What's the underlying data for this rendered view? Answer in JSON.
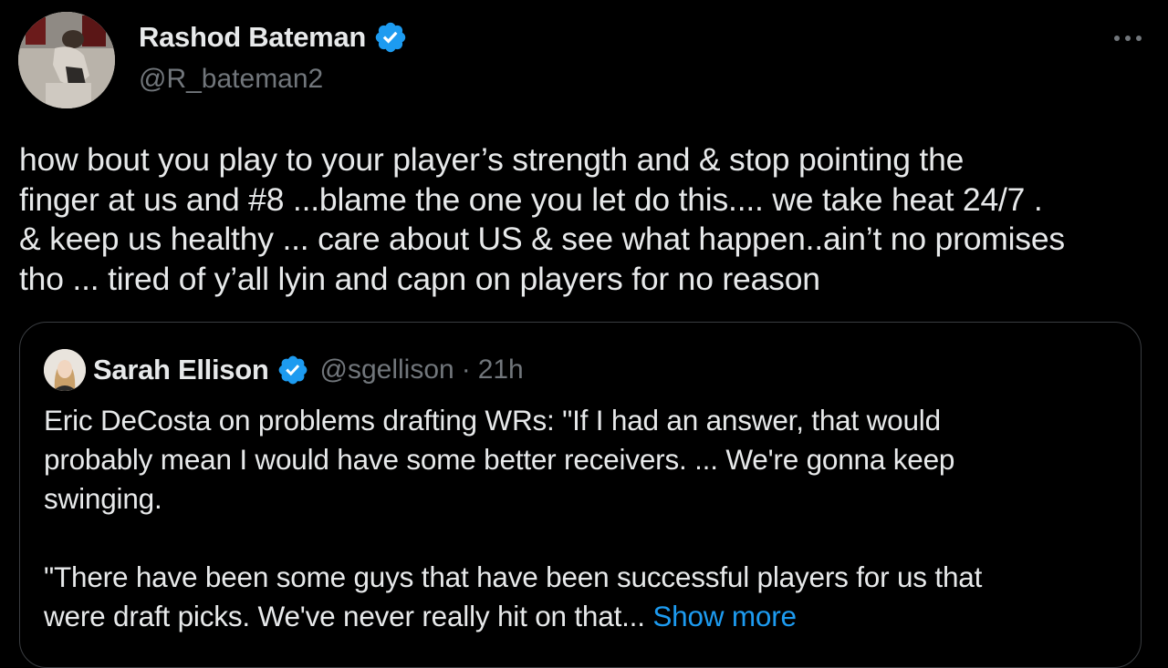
{
  "author": {
    "name": "Rashod Bateman",
    "handle": "@R_bateman2"
  },
  "icons": {
    "verified": "verified-badge-icon",
    "more": "more-options-icon"
  },
  "colors": {
    "verified_blue": "#1d9bf0",
    "link_blue": "#1d9bf0",
    "muted": "#71767b",
    "text": "#e7e9ea",
    "background": "#000000"
  },
  "tweet": {
    "text": "how bout you play to your player’s strength and & stop pointing the\nfinger at us and #8 ...blame the one you let do this.... we take heat 24/7 .\n& keep us healthy ... care about US & see what happen..ain’t no promises\ntho ... tired of y’all lyin and capn on players for no reason"
  },
  "quote": {
    "name": "Sarah Ellison",
    "handle": "@sgellison",
    "separator": "·",
    "time": "21h",
    "paragraph1": "Eric DeCosta on problems drafting WRs: \"If I had an answer, that would\nprobably mean I would have some better receivers. ... We're gonna keep\nswinging.",
    "paragraph2": "\"There have been some guys that have been successful players for us that\nwere draft picks. We've never really hit on that... ",
    "show_more": "Show more"
  }
}
